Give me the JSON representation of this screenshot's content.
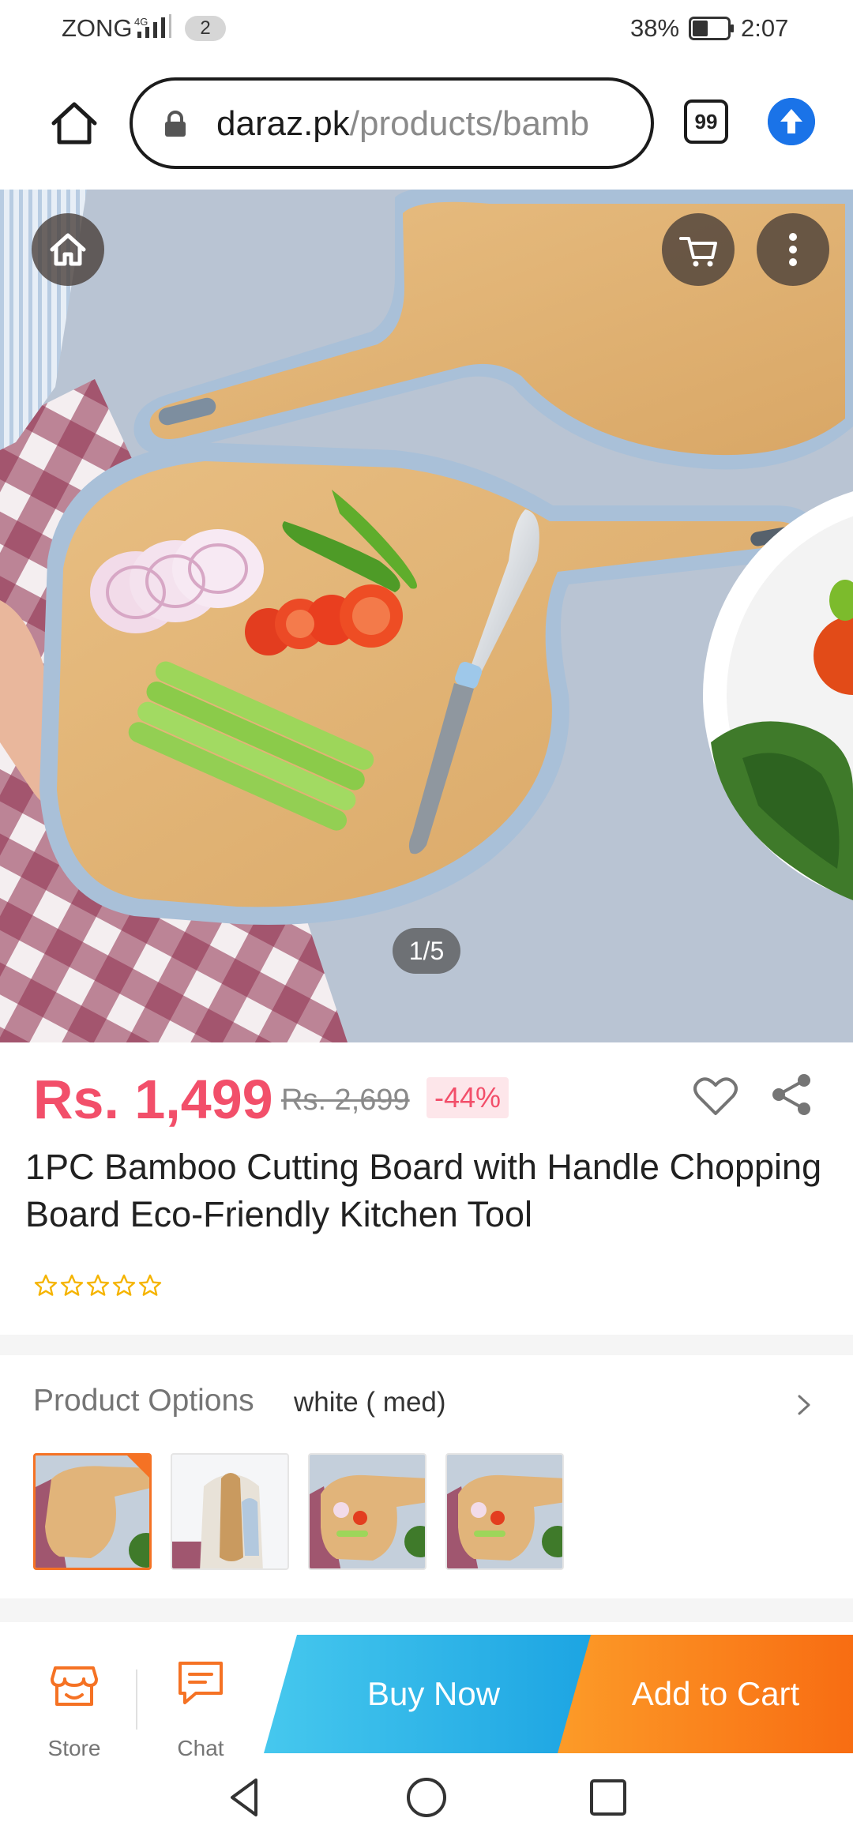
{
  "status_bar": {
    "carrier": "ZONG",
    "network": "4G",
    "sim_badge": "2",
    "battery_percent": "38%",
    "time": "2:07"
  },
  "browser": {
    "url_host": "daraz.pk",
    "url_path": "/products/bamb",
    "tab_count": "99",
    "accent_color": "#1a73e8"
  },
  "hero": {
    "image_counter": "1/5",
    "icons": [
      "home-icon",
      "cart-icon",
      "more-vertical-icon"
    ]
  },
  "product": {
    "price": "Rs. 1,499",
    "original_price": "Rs. 2,699",
    "discount": "-44%",
    "title": "1PC Bamboo Cutting Board with Handle Chopping Board Eco-Friendly Kitchen Tool",
    "rating_stars": 0,
    "price_color": "#f24f6a"
  },
  "options": {
    "label": "Product Options",
    "selected_value": "white ( med)",
    "thumbnail_count": 4
  },
  "actions": {
    "store_label": "Store",
    "chat_label": "Chat",
    "buy_now_label": "Buy Now",
    "add_to_cart_label": "Add to Cart",
    "brand_orange": "#f57224"
  }
}
